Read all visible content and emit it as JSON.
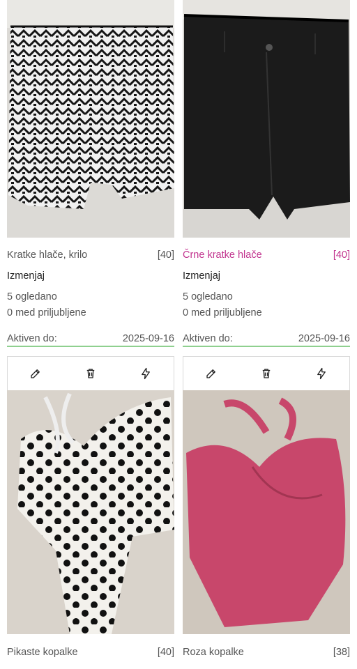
{
  "listings": [
    {
      "title": "Kratke hlače, krilo",
      "size": "[40]",
      "action": "Izmenjaj",
      "views": "5 ogledano",
      "favorites": "0 med priljubljene",
      "active_label": "Aktiven do:",
      "active_date": "2025-09-16"
    },
    {
      "title": "Črne kratke hlače",
      "size": "[40]",
      "action": "Izmenjaj",
      "views": "5 ogledano",
      "favorites": "0 med priljubljene",
      "active_label": "Aktiven do:",
      "active_date": "2025-09-16"
    },
    {
      "title": "Pikaste kopalke",
      "size": "[40]"
    },
    {
      "title": "Roza kopalke",
      "size": "[38]"
    }
  ],
  "toolbar_icons": [
    "edit-icon",
    "trash-icon",
    "boost-icon"
  ],
  "colors": {
    "accent_pink": "#c2358f",
    "active_underline": "#8fd08f",
    "toolbar_border": "#d9d9d9"
  }
}
